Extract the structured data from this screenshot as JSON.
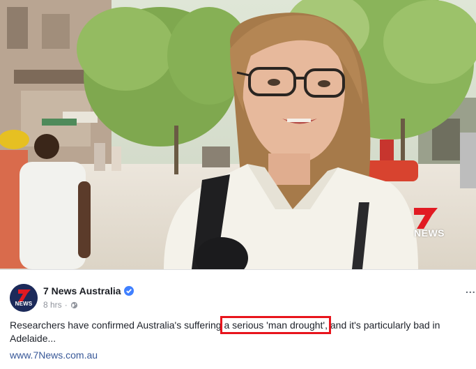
{
  "video": {
    "overlay_logo": "NEWS",
    "colors": {
      "logo_red": "#e11a22",
      "shirt": "#f4f2ea"
    }
  },
  "post": {
    "page_name": "7 News Australia",
    "avatar_text": "NEWS",
    "time": "8 hrs",
    "separator": "·",
    "audience_icon": "globe-icon",
    "text_before": "Researchers have confirmed Australia's suffering ",
    "text_highlight": "a serious 'man drought',",
    "text_after": " and it's particularly bad in Adelaide...",
    "link": "www.7News.com.au",
    "more_label": "...",
    "colors": {
      "name": "#1a1d23",
      "meta": "#90949c",
      "link": "#385898",
      "highlight_box": "#e8141c",
      "verified": "#4080ff"
    }
  }
}
